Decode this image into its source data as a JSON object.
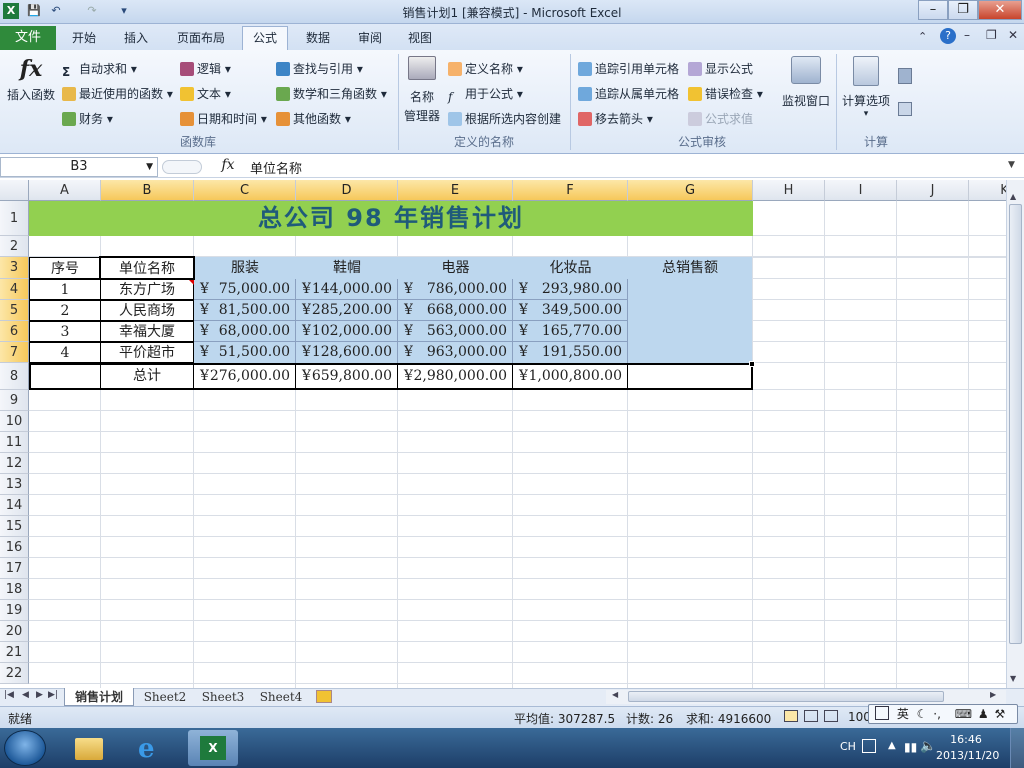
{
  "window": {
    "title": "销售计划1  [兼容模式] - Microsoft Excel",
    "app_icon": "X"
  },
  "qat": {
    "save_icon": "save-icon",
    "undo_icon": "undo-icon",
    "redo_icon": "redo-icon",
    "customize_icon": "customize-icon"
  },
  "ribbon_tabs": [
    "文件",
    "开始",
    "插入",
    "页面布局",
    "公式",
    "数据",
    "审阅",
    "视图"
  ],
  "active_tab": "公式",
  "ribbon": {
    "insert_function": "插入函数",
    "autosum": "自动求和",
    "recent": "最近使用的函数",
    "finance": "财务",
    "logic": "逻辑",
    "text": "文本",
    "datetime": "日期和时间",
    "lookup": "查找与引用",
    "math": "数学和三角函数",
    "other": "其他函数",
    "group_library": "函数库",
    "name_mgr_line1": "名称",
    "name_mgr_line2": "管理器",
    "define_name": "定义名称",
    "use_in_formula": "用于公式",
    "create_from_sel": "根据所选内容创建",
    "group_names": "定义的名称",
    "trace_prec": "追踪引用单元格",
    "trace_dep": "追踪从属单元格",
    "remove_arrows": "移去箭头",
    "show_formulas": "显示公式",
    "error_check": "错误检查",
    "eval_formula": "公式求值",
    "watch_window": "监视窗口",
    "group_audit": "公式审核",
    "calc_options": "计算选项",
    "group_calc": "计算"
  },
  "formula_bar": {
    "name_box": "B3",
    "fx": "fx",
    "value": "单位名称"
  },
  "columns": [
    "A",
    "B",
    "C",
    "D",
    "E",
    "F",
    "G",
    "H",
    "I",
    "J",
    "K"
  ],
  "rows": [
    "1",
    "2",
    "3",
    "4",
    "5",
    "6",
    "7",
    "8",
    "9",
    "10",
    "11",
    "12",
    "13",
    "14",
    "15",
    "16",
    "17",
    "18",
    "19",
    "20",
    "21",
    "22"
  ],
  "sheet": {
    "title": "总公司 98 年销售计划",
    "headers": [
      "序号",
      "单位名称",
      "服装",
      "鞋帽",
      "电器",
      "化妆品",
      "总销售额"
    ],
    "currency": "¥",
    "data": [
      [
        "1",
        "东方广场",
        "75,000.00",
        "144,000.00",
        "786,000.00",
        "293,980.00"
      ],
      [
        "2",
        "人民商场",
        "81,500.00",
        "285,200.00",
        "668,000.00",
        "349,500.00"
      ],
      [
        "3",
        "幸福大厦",
        "68,000.00",
        "102,000.00",
        "563,000.00",
        "165,770.00"
      ],
      [
        "4",
        "平价超市",
        "51,500.00",
        "128,600.00",
        "963,000.00",
        "191,550.00"
      ]
    ],
    "total_label": "总计",
    "totals": [
      "276,000.00",
      "659,800.00",
      "2,980,000.00",
      "1,000,800.00"
    ]
  },
  "sheet_tabs": [
    "销售计划",
    "Sheet2",
    "Sheet3",
    "Sheet4"
  ],
  "active_sheet": "销售计划",
  "status": {
    "ready": "就绪",
    "average": "平均值: 307287.5",
    "count": "计数: 26",
    "sum": "求和: 4916600",
    "zoom": "100"
  },
  "ime": {
    "lang": "英"
  },
  "taskbar": {
    "lang": "CH",
    "time": "16:46",
    "date": "2013/11/20"
  },
  "colors": {
    "title_fill": "#92d050",
    "header_fill": "#bdd7ee",
    "title_text": "#1f5b7a",
    "file_tab": "#2f8a3b"
  }
}
